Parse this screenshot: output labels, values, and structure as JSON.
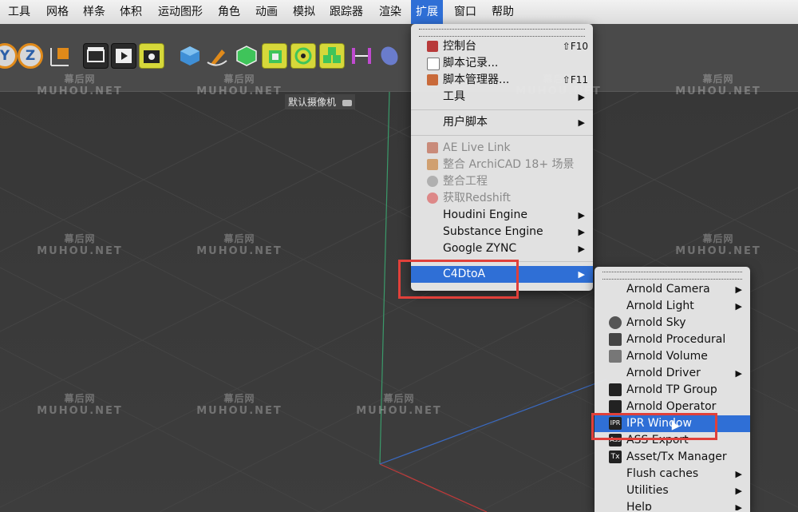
{
  "menubar": {
    "items": [
      "工具",
      "网格",
      "样条",
      "体积",
      "运动图形",
      "角色",
      "动画",
      "模拟",
      "跟踪器",
      "渲染",
      "扩展",
      "窗口",
      "帮助"
    ],
    "active": "扩展"
  },
  "toolbar": {
    "axis_labels": [
      "Y",
      "Z"
    ]
  },
  "viewport": {
    "camera_label": "默认摄像机"
  },
  "watermark": {
    "cn": "幕后网",
    "en": "MUHOU.NET"
  },
  "extensions_menu": {
    "items": [
      {
        "label": "控制台",
        "shortcut": "⇧F10",
        "icon": "console-icon"
      },
      {
        "label": "脚本记录...",
        "icon": "script-log-icon"
      },
      {
        "label": "脚本管理器...",
        "shortcut": "⇧F11",
        "icon": "script-manager-icon"
      },
      {
        "label": "工具",
        "submenu": true
      },
      {
        "label": "用户脚本",
        "submenu": true
      },
      {
        "label": "AE Live Link",
        "disabled": true,
        "icon": "ae-icon"
      },
      {
        "label": "整合 ArchiCAD 18+ 场景",
        "disabled": true,
        "icon": "archicad-icon"
      },
      {
        "label": "整合工程",
        "disabled": true,
        "icon": "merge-icon"
      },
      {
        "label": "获取Redshift",
        "disabled": true,
        "icon": "redshift-icon"
      },
      {
        "label": "Houdini Engine",
        "submenu": true
      },
      {
        "label": "Substance Engine",
        "submenu": true
      },
      {
        "label": "Google ZYNC",
        "submenu": true
      },
      {
        "label": "C4DtoA",
        "submenu": true,
        "selected": true
      }
    ]
  },
  "c4dtoa_menu": {
    "items": [
      {
        "label": "Arnold Camera",
        "submenu": true
      },
      {
        "label": "Arnold Light",
        "submenu": true
      },
      {
        "label": "Arnold Sky",
        "icon": "sky-icon"
      },
      {
        "label": "Arnold Procedural",
        "icon": "procedural-icon"
      },
      {
        "label": "Arnold Volume",
        "icon": "volume-icon"
      },
      {
        "label": "Arnold Driver",
        "submenu": true
      },
      {
        "label": "Arnold TP Group",
        "icon": "tp-group-icon"
      },
      {
        "label": "Arnold Operator",
        "icon": "operator-icon"
      },
      {
        "label": "IPR Window",
        "icon": "ipr-icon",
        "icon_text": "IPR",
        "selected": true
      },
      {
        "label": "ASS Export",
        "icon": "ass-icon",
        "icon_text": "Ass"
      },
      {
        "label": "Asset/Tx Manager",
        "icon": "tx-icon",
        "icon_text": "Tx"
      },
      {
        "label": "Flush caches",
        "submenu": true
      },
      {
        "label": "Utilities",
        "submenu": true
      },
      {
        "label": "Help",
        "submenu": true
      }
    ]
  },
  "colors": {
    "highlight": "#2f6fd6",
    "annotation": "#e0403a"
  }
}
